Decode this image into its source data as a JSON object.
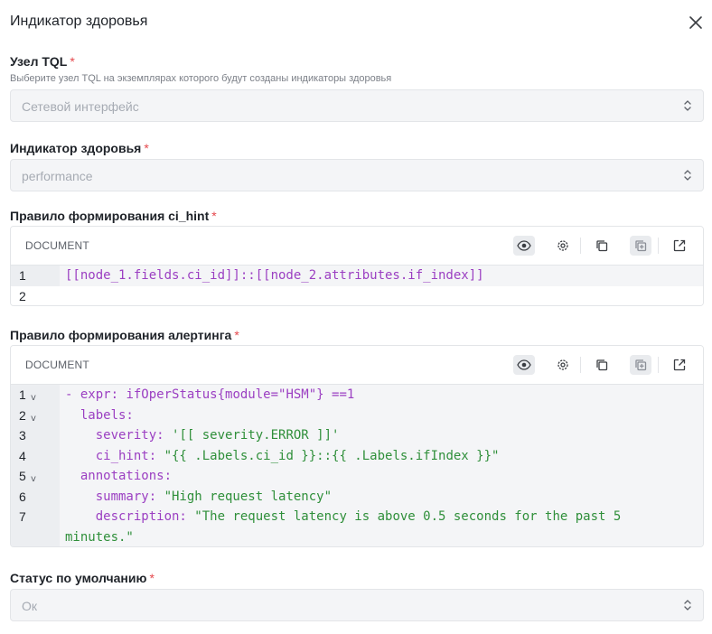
{
  "dialog": {
    "title": "Индикатор здоровья"
  },
  "fields": {
    "tql_node": {
      "label": "Узел TQL",
      "required_mark": "*",
      "hint": "Выберите узел TQL на экземплярах которого будут созданы индикаторы здоровья",
      "value": "Сетевой интерфейс"
    },
    "health_indicator": {
      "label": "Индикатор здоровья",
      "required_mark": "*",
      "value": "performance"
    },
    "ci_hint_rule": {
      "label": "Правило формирования ci_hint",
      "required_mark": "*",
      "editor_mode": "DOCUMENT",
      "lines": [
        {
          "n": "1",
          "text": "[[node_1.fields.ci_id]]::[[node_2.attributes.if_index]]"
        },
        {
          "n": "2",
          "text": ""
        }
      ]
    },
    "alerting_rule": {
      "label": "Правило формирования алертинга",
      "required_mark": "*",
      "editor_mode": "DOCUMENT",
      "lines": [
        {
          "n": "1",
          "fold": "v",
          "a": "- expr: ",
          "b": "ifOperStatus{module=\"HSM\"} ==1"
        },
        {
          "n": "2",
          "fold": "v",
          "a": "  labels:",
          "b": ""
        },
        {
          "n": "3",
          "a": "    severity: ",
          "b": "'[[ severity.ERROR ]]'"
        },
        {
          "n": "4",
          "a": "    ci_hint: ",
          "b": "\"{{ .Labels.ci_id }}::{{ .Labels.ifIndex }}\""
        },
        {
          "n": "5",
          "fold": "v",
          "a": "  annotations:",
          "b": ""
        },
        {
          "n": "6",
          "a": "    summary: ",
          "b": "\"High request latency\""
        },
        {
          "n": "7",
          "a": "    description: ",
          "b": "\"The request latency is above 0.5 seconds for the past 5"
        },
        {
          "n": "",
          "a": "",
          "b": "minutes.\""
        }
      ]
    },
    "default_status": {
      "label": "Статус по умолчанию",
      "required_mark": "*",
      "value": "Ок"
    }
  },
  "toolbar_icons": [
    "eye-icon",
    "settings-icon",
    "copy-icon",
    "copy-add-icon",
    "expand-icon"
  ],
  "colors": {
    "required": "#e5484d",
    "keyword": "#9b3fc2",
    "string": "#2f8f3a"
  }
}
